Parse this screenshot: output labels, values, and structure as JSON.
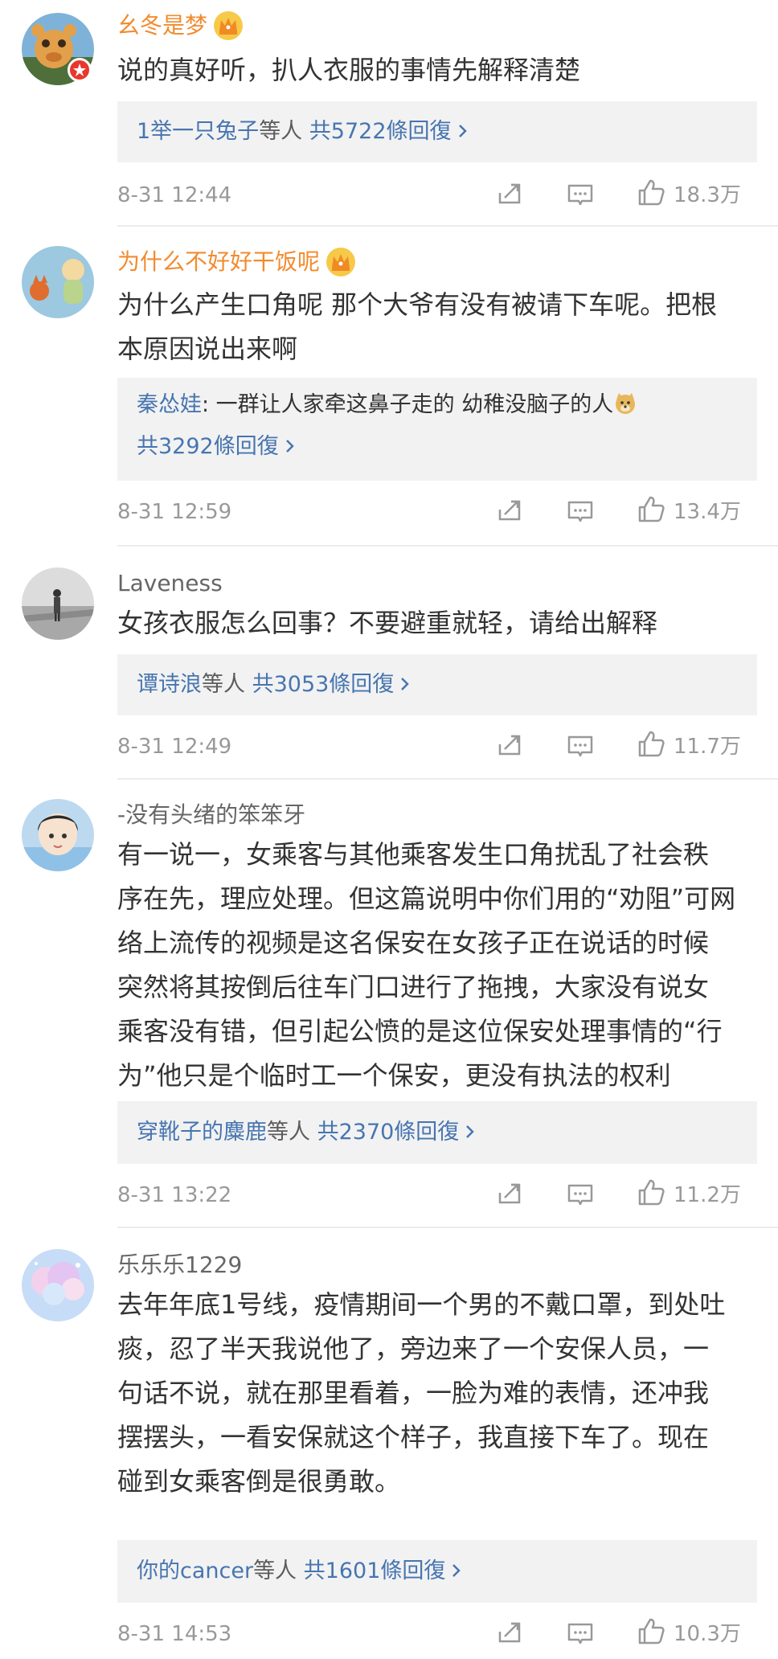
{
  "comments": [
    {
      "username": "幺冬是梦",
      "text_lines": [
        "说的真好听，扒人衣服的事情先解释清楚"
      ],
      "reply": {
        "users_prefix": "1举一只兔子",
        "users_suffix": "等人",
        "count_label": "共5722條回復"
      },
      "time": "8-31 12:44",
      "likes": "18.3万"
    },
    {
      "username": "为什么不好好干饭呢",
      "text_lines": [
        "为什么产生口角呢 那个大爷有没有被请下车呢。把根",
        "本原因说出来啊"
      ],
      "reply": {
        "quote_user": "秦怂娃",
        "quote_text": ": 一群让人家牵这鼻子走的 幼稚没脑子的人",
        "count_label": "共3292條回復"
      },
      "time": "8-31 12:59",
      "likes": "13.4万"
    },
    {
      "username": "Laveness",
      "text_lines": [
        "女孩衣服怎么回事？不要避重就轻，请给出解释"
      ],
      "reply": {
        "users_prefix": "谭诗浪",
        "users_suffix": "等人",
        "count_label": "共3053條回復"
      },
      "time": "8-31 12:49",
      "likes": "11.7万"
    },
    {
      "username": "-没有头绪的笨笨牙",
      "text_lines": [
        "有一说一，女乘客与其他乘客发生口角扰乱了社会秩",
        "序在先，理应处理。但这篇说明中你们用的“劝阻”可网",
        "络上流传的视频是这名保安在女孩子正在说话的时候",
        "突然将其按倒后往车门口进行了拖拽，大家没有说女",
        "乘客没有错，但引起公愤的是这位保安处理事情的“行",
        "为”他只是个临时工一个保安，更没有执法的权利"
      ],
      "reply": {
        "users_prefix": "穿靴子的麋鹿",
        "users_suffix": "等人",
        "count_label": "共2370條回復"
      },
      "time": "8-31 13:22",
      "likes": "11.2万"
    },
    {
      "username": "乐乐乐1229",
      "text_lines": [
        "去年年底1号线，疫情期间一个男的不戴口罩，到处吐",
        "痰，忍了半天我说他了，旁边来了一个安保人员，一",
        "句话不说，就在那里看着，一脸为难的表情，还冲我",
        "摆摆头，一看安保就这个样子，我直接下车了。现在",
        "碰到女乘客倒是很勇敢。"
      ],
      "reply": {
        "users_prefix": "你的cancer",
        "users_suffix": "等人",
        "count_label": "共1601條回復"
      },
      "time": "8-31 14:53",
      "likes": "10.3万"
    }
  ],
  "icons": {
    "share": "share-icon",
    "comment": "comment-icon",
    "like": "thumbs-up-icon",
    "crown": "crown-icon",
    "emoji": "doge-emoji-icon",
    "chevron": "chevron-right-icon"
  },
  "colors": {
    "vip_name": "#f28b2f",
    "link_blue": "#4775b0",
    "meta_grey": "#999999",
    "reply_bg": "#f2f2f2"
  }
}
